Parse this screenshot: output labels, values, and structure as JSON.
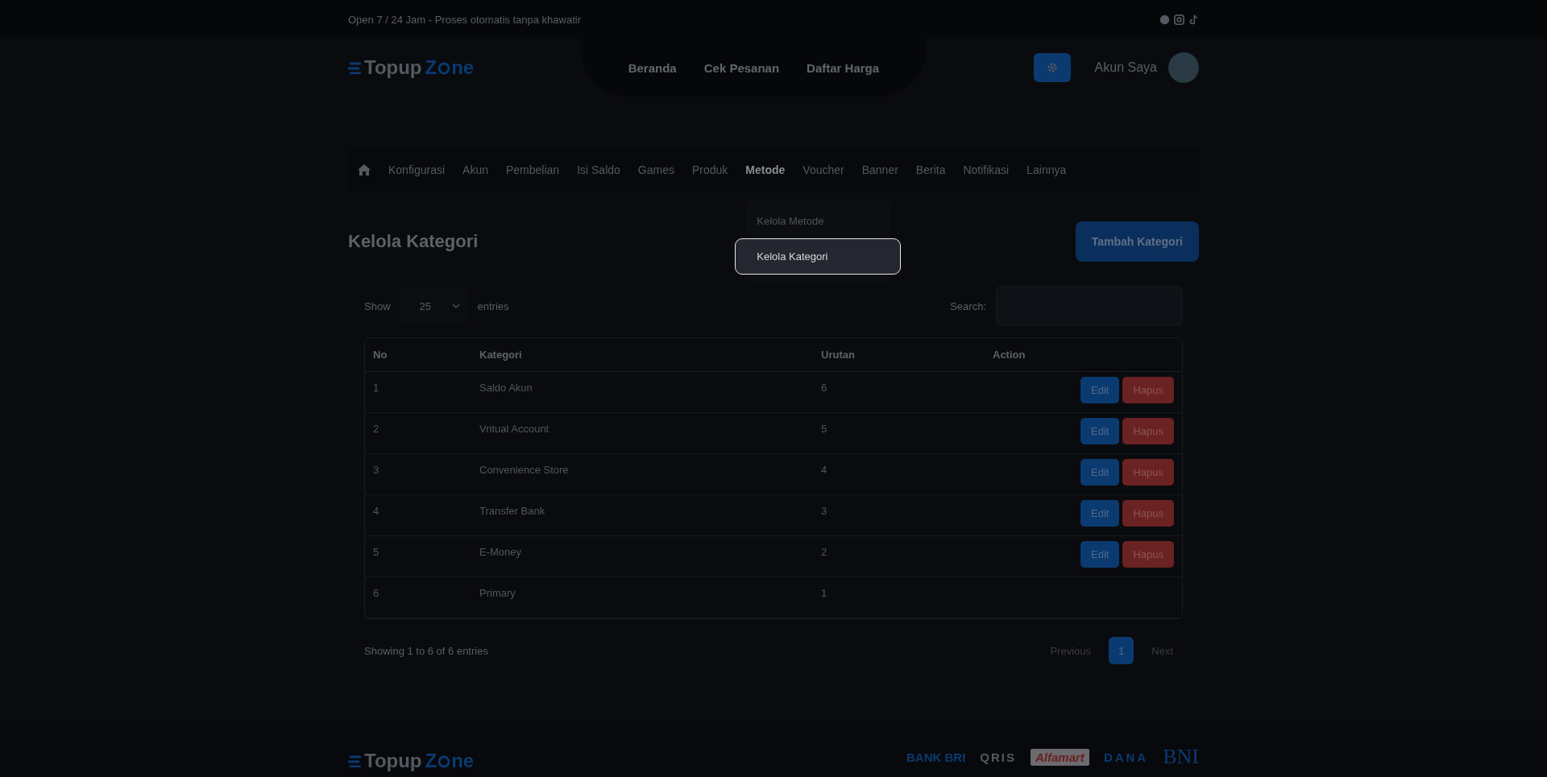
{
  "topbar": {
    "text": "Open 7 / 24 Jam - Proses otomatis tanpa khawatir"
  },
  "header": {
    "logo": {
      "first": "Topup",
      "second_start": "Z",
      "second_end": "ne"
    },
    "nav": [
      "Beranda",
      "Cek Pesanan",
      "Daftar Harga"
    ],
    "account": "Akun Saya"
  },
  "admin_menu": [
    {
      "label": "Konfigurasi",
      "selected": false
    },
    {
      "label": "Akun",
      "selected": false
    },
    {
      "label": "Pembelian",
      "selected": false
    },
    {
      "label": "Isi Saldo",
      "selected": false
    },
    {
      "label": "Games",
      "selected": false
    },
    {
      "label": "Produk",
      "selected": false
    },
    {
      "label": "Metode",
      "selected": true
    },
    {
      "label": "Voucher",
      "selected": false
    },
    {
      "label": "Banner",
      "selected": false
    },
    {
      "label": "Berita",
      "selected": false
    },
    {
      "label": "Notifikasi",
      "selected": false
    },
    {
      "label": "Lainnya",
      "selected": false
    }
  ],
  "dropdown": [
    {
      "label": "Kelola Metode",
      "selected": false
    },
    {
      "label": "Kelola Kategori",
      "selected": true
    }
  ],
  "page": {
    "title": "Kelola Kategori",
    "add_button": "Tambah Kategori"
  },
  "table_controls": {
    "show_label": "Show",
    "page_size": "25",
    "entries_label": "entries",
    "search_label": "Search:"
  },
  "table": {
    "columns": [
      "No",
      "Kategori",
      "Urutan",
      "Action"
    ],
    "rows": [
      {
        "no": "1",
        "kategori": "Saldo Akun",
        "urutan": "6",
        "buttons": [
          {
            "label": "Edit",
            "kind": "edit"
          },
          {
            "label": "Hapus",
            "kind": "delete"
          }
        ]
      },
      {
        "no": "2",
        "kategori": "Vritual Account",
        "urutan": "5",
        "buttons": [
          {
            "label": "Edit",
            "kind": "edit"
          },
          {
            "label": "Hapus",
            "kind": "delete"
          }
        ]
      },
      {
        "no": "3",
        "kategori": "Convenience Store",
        "urutan": "4",
        "buttons": [
          {
            "label": "Edit",
            "kind": "edit"
          },
          {
            "label": "Hapus",
            "kind": "delete"
          }
        ]
      },
      {
        "no": "4",
        "kategori": "Transfer Bank",
        "urutan": "3",
        "buttons": [
          {
            "label": "Edit",
            "kind": "edit"
          },
          {
            "label": "Hapus",
            "kind": "delete"
          }
        ]
      },
      {
        "no": "5",
        "kategori": "E-Money",
        "urutan": "2",
        "buttons": [
          {
            "label": "Edit",
            "kind": "edit"
          },
          {
            "label": "Hapus",
            "kind": "delete"
          }
        ]
      },
      {
        "no": "6",
        "kategori": "Primary",
        "urutan": "1"
      }
    ]
  },
  "table_info": "Showing 1 to 6 of 6 entries",
  "pagination": [
    {
      "label": "Previous",
      "selected": false,
      "disabled": true
    },
    {
      "label": "1",
      "selected": true,
      "disabled": false
    },
    {
      "label": "Next",
      "selected": false,
      "disabled": true
    }
  ],
  "footer": {
    "logo": {
      "first": "Topup",
      "second_start": "Z",
      "second_end": "ne"
    },
    "payments": [
      {
        "label": "BANK BRI",
        "kind": "bri"
      },
      {
        "label": "QRIS",
        "kind": "qris"
      },
      {
        "label": "Alfamart",
        "kind": "alfamart"
      },
      {
        "label": "DANA",
        "kind": "dana"
      },
      {
        "label": "BNI",
        "kind": "bni"
      }
    ]
  }
}
